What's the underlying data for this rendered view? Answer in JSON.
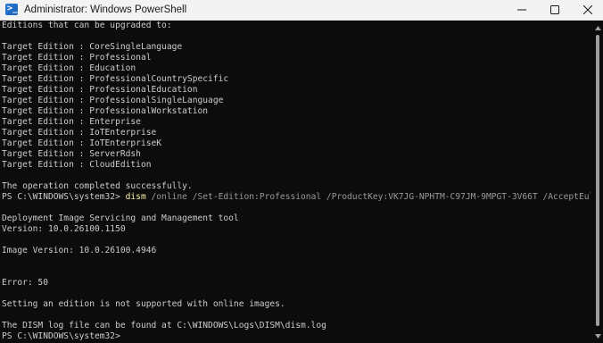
{
  "window": {
    "title": "Administrator: Windows PowerShell",
    "icon": "powershell-icon",
    "controls": [
      "minimize-icon",
      "maximize-icon",
      "close-icon"
    ]
  },
  "terminal": {
    "lines": [
      "Editions that can be upgraded to:",
      "",
      "Target Edition : CoreSingleLanguage",
      "Target Edition : Professional",
      "Target Edition : Education",
      "Target Edition : ProfessionalCountrySpecific",
      "Target Edition : ProfessionalEducation",
      "Target Edition : ProfessionalSingleLanguage",
      "Target Edition : ProfessionalWorkstation",
      "Target Edition : Enterprise",
      "Target Edition : IoTEnterprise",
      "Target Edition : IoTEnterpriseK",
      "Target Edition : ServerRdsh",
      "Target Edition : CloudEdition",
      "",
      "The operation completed successfully."
    ],
    "prompt_1": "PS C:\\WINDOWS\\system32> ",
    "command": {
      "name": "dism",
      "param_online": " /online",
      "param_set_edition": " /Set-Edition:Professional",
      "param_product_key": " /ProductKey:VK7JG-NPHTM-C97JM-9MPGT-3V66T",
      "param_accept_eula": " /AcceptEula"
    },
    "output_lines": [
      "",
      "Deployment Image Servicing and Management tool",
      "Version: 10.0.26100.1150",
      "",
      "Image Version: 10.0.26100.4946",
      "",
      "",
      "Error: 50",
      "",
      "Setting an edition is not supported with online images.",
      "",
      "The DISM log file can be found at C:\\WINDOWS\\Logs\\DISM\\dism.log"
    ],
    "prompt_2": "PS C:\\WINDOWS\\system32> ",
    "colors": {
      "background": "#0c0c0c",
      "foreground": "#cccccc",
      "command": "#f9f1a5",
      "parameter": "#999999"
    }
  }
}
